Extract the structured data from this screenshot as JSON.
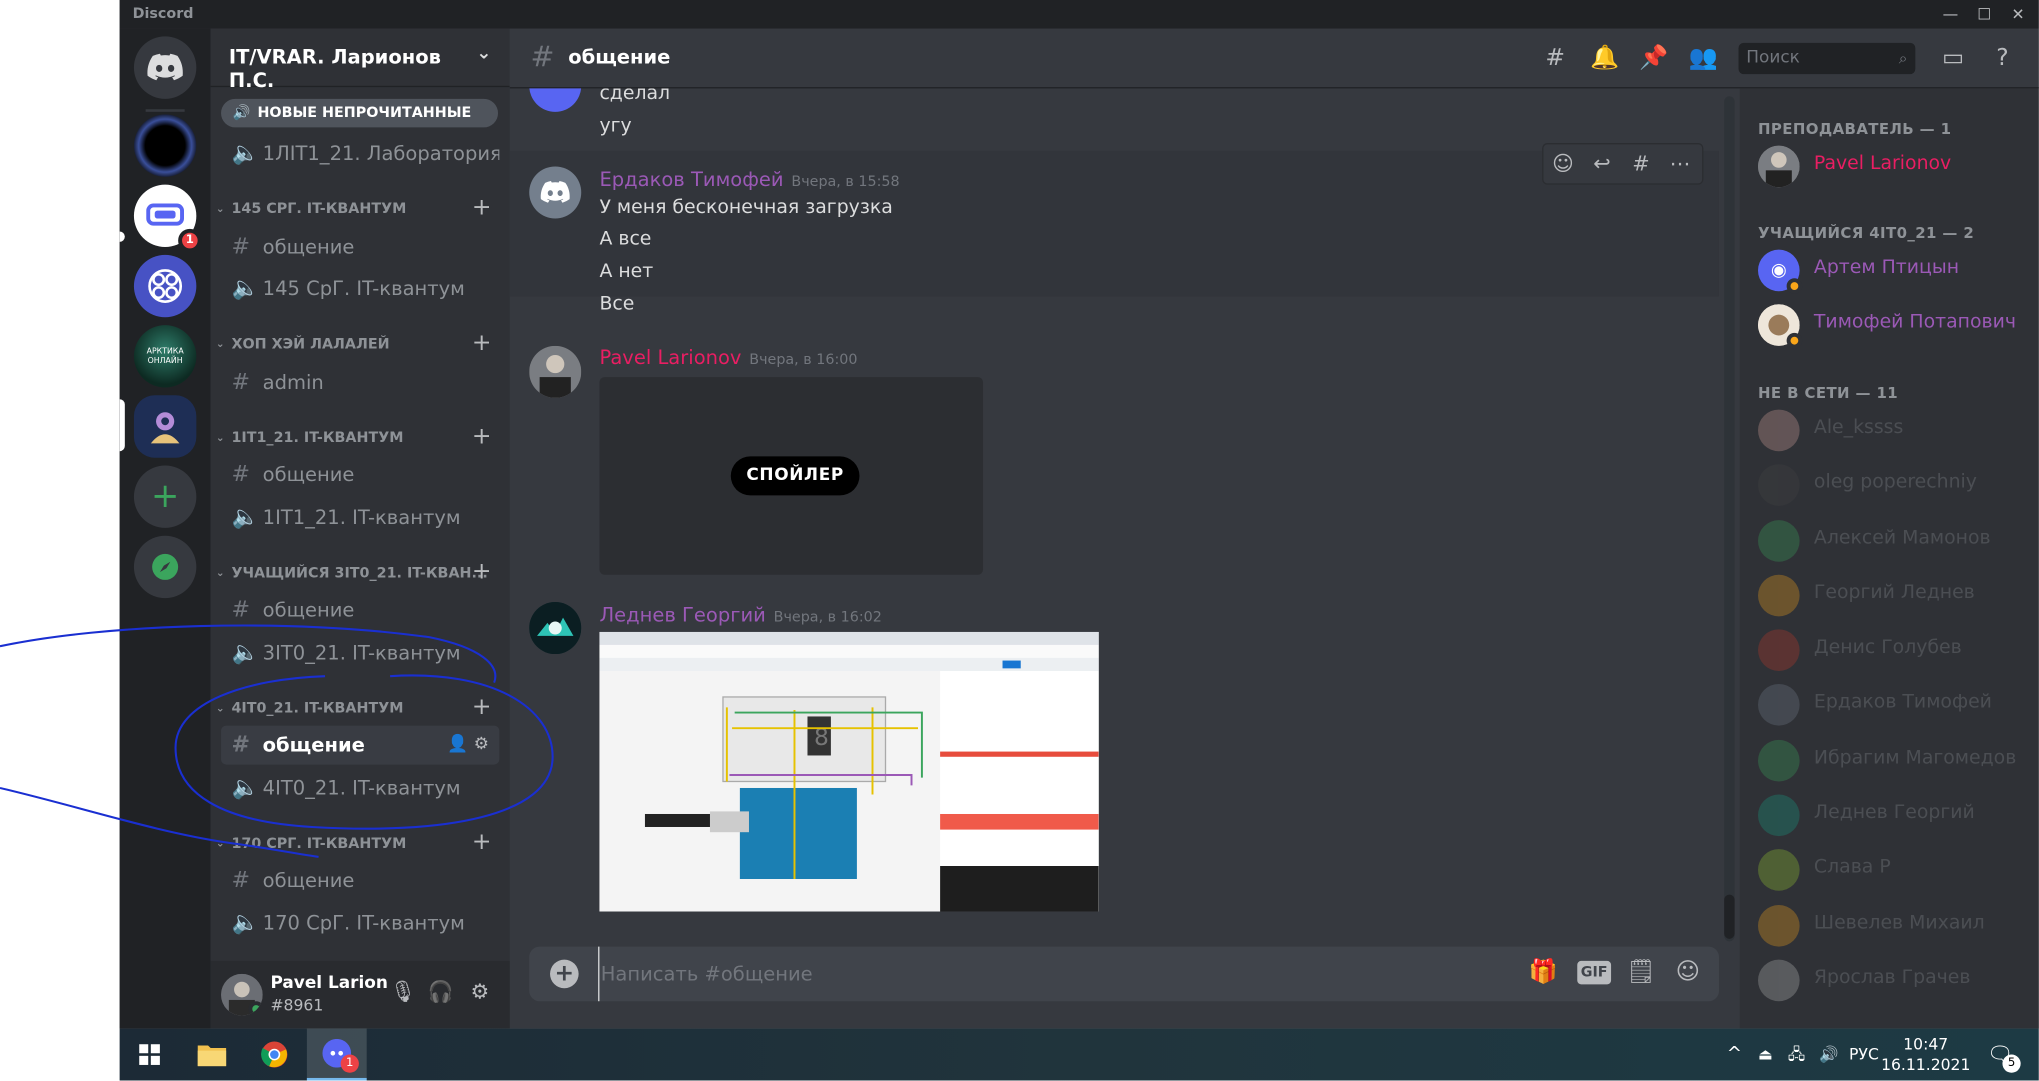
{
  "window": {
    "title": "Discord",
    "controls": [
      "—",
      "☐",
      "✕"
    ]
  },
  "guilds": [
    {
      "name": "home",
      "icon": "discord-logo-icon",
      "color": "#5865f2"
    },
    {
      "name": "dark-sphere",
      "icon": "planet-icon",
      "color": "#0b1020"
    },
    {
      "name": "vr-server",
      "icon": "vr-headset-icon",
      "color": "#5865f2",
      "badge": "1"
    },
    {
      "name": "pattern-server",
      "icon": "circuit-icon",
      "color": "#4752c4"
    },
    {
      "name": "arctic",
      "label": "АРКТИКА ОНЛАЙН",
      "color": "#1b4a3c"
    },
    {
      "name": "character",
      "icon": "character-icon",
      "color": "#1e2e55"
    },
    {
      "name": "add-server",
      "glyph": "+",
      "color": "#3ba55d"
    },
    {
      "name": "explore",
      "glyph": "🧭",
      "color": "#3ba55d"
    }
  ],
  "server": {
    "name": "IT/VRAR. Ларионов П.С.",
    "chevron": "⌄"
  },
  "unread_banner": "НОВЫЕ НЕПРОЧИТАННЫЕ",
  "channel_list": {
    "top_voice": "1ЛIT1_21. Лаборатория ...",
    "categories": [
      {
        "name": "145 СРГ. IT-КВАНТУМ",
        "channels": [
          {
            "type": "text",
            "name": "общение"
          },
          {
            "type": "voice",
            "name": "145 СрГ. IT-квантум"
          }
        ]
      },
      {
        "name": "ХОП ХЭЙ ЛАЛАЛЕЙ",
        "channels": [
          {
            "type": "text",
            "name": "admin"
          }
        ]
      },
      {
        "name": "1IT1_21. IT-КВАНТУМ",
        "channels": [
          {
            "type": "text",
            "name": "общение"
          },
          {
            "type": "voice",
            "name": "1IT1_21. IT-квантум"
          }
        ]
      },
      {
        "name": "УЧАЩИЙСЯ 3IT0_21. IT-КВАН...",
        "channels": [
          {
            "type": "text",
            "name": "общение"
          },
          {
            "type": "voice",
            "name": "3IT0_21. IT-квантум"
          }
        ]
      },
      {
        "name": "4IT0_21. IT-КВАНТУМ",
        "channels": [
          {
            "type": "text",
            "name": "общение",
            "selected": true
          },
          {
            "type": "voice",
            "name": "4IT0_21. IT-квантум"
          }
        ]
      },
      {
        "name": "170 СРГ. IT-КВАНТУМ",
        "channels": [
          {
            "type": "text",
            "name": "общение"
          },
          {
            "type": "voice",
            "name": "170 СрГ. IT-квантум"
          }
        ]
      }
    ]
  },
  "user": {
    "name": "Pavel Larion...",
    "tag": "#8961",
    "status_color": "#3ba55d"
  },
  "chat": {
    "channel": "общение",
    "search_placeholder": "Поиск",
    "messages": {
      "prev_lines": [
        "сделал",
        "угу"
      ],
      "m1": {
        "author": "Ердаков Тимофей",
        "author_color": "#9b59b6",
        "time": "Вчера, в 15:58",
        "lines": [
          "У меня бесконечная загрузка",
          "А все",
          "А нет",
          "Все"
        ]
      },
      "m2": {
        "author": "Pavel Larionov",
        "author_color": "#e91e63",
        "time": "Вчера, в 16:00",
        "spoiler": "СПОЙЛЕР"
      },
      "m3": {
        "author": "Леднев Георгий",
        "author_color": "#9b59b6",
        "time": "Вчера, в 16:02",
        "attachment": "tinkercad-arduino-screenshot"
      }
    },
    "composer_placeholder": "Написать #общение",
    "composer_gif": "GIF"
  },
  "members": {
    "groups": [
      {
        "title": "ПРЕПОДАВАТЕЛЬ — 1",
        "members": [
          {
            "name": "Pavel Larionov",
            "color": "#e91e63"
          }
        ]
      },
      {
        "title": "УЧАЩИЙСЯ 4IT0_21 — 2",
        "members": [
          {
            "name": "Артем Птицын",
            "color": "#9b59b6"
          },
          {
            "name": "Тимофей Потапович",
            "color": "#9b59b6"
          }
        ]
      },
      {
        "title": "НЕ В СЕТИ — 11",
        "members": [
          {
            "name": "Ale_kssss"
          },
          {
            "name": "oleg poperechniy"
          },
          {
            "name": "Алексей Мамонов"
          },
          {
            "name": "Георгий Леднев"
          },
          {
            "name": "Денис Голубев"
          },
          {
            "name": "Ердаков Тимофей"
          },
          {
            "name": "Ибрагим Магомедов"
          },
          {
            "name": "Леднев Георгий"
          },
          {
            "name": "Слава Р"
          },
          {
            "name": "Шевелев Михаил"
          },
          {
            "name": "Ярослав Грачев"
          }
        ]
      }
    ]
  },
  "taskbar": {
    "lang": "РУС",
    "time": "10:47",
    "date": "16.11.2021",
    "notifications": "5",
    "discord_badge": "1"
  }
}
